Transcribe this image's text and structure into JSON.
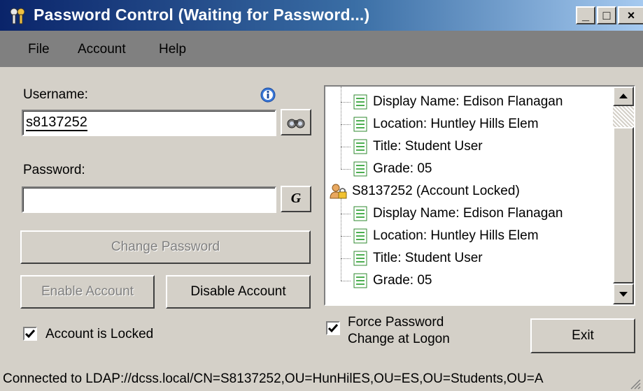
{
  "window": {
    "title": "Password Control  (Waiting for Password...)",
    "controls": {
      "minimize": "_",
      "maximize": "□",
      "close": "×"
    }
  },
  "menu": {
    "items": [
      "File",
      "Account",
      "Help"
    ]
  },
  "username": {
    "label": "Username:",
    "value": "s8137252",
    "info_icon": "info-icon",
    "lookup_icon": "binoculars-icon"
  },
  "password": {
    "label": "Password:",
    "value": "",
    "generate_label": "G"
  },
  "buttons": {
    "change_password": "Change Password",
    "enable_account": "Enable Account",
    "disable_account": "Disable Account",
    "exit": "Exit"
  },
  "checks": {
    "account_locked": {
      "label": "Account is Locked",
      "checked": true
    },
    "force_change": {
      "line1": "Force Password",
      "line2": "Change at Logon",
      "checked": true
    }
  },
  "tree": {
    "rows": [
      {
        "level": 1,
        "icon": "document-icon",
        "text": "Display Name: Edison Flanagan"
      },
      {
        "level": 1,
        "icon": "document-icon",
        "text": "Location: Huntley Hills Elem"
      },
      {
        "level": 1,
        "icon": "document-icon",
        "text": "Title: Student User"
      },
      {
        "level": 1,
        "icon": "document-icon",
        "text": "Grade: 05"
      },
      {
        "level": 0,
        "icon": "locked-user-icon",
        "text": "S8137252 (Account Locked)"
      },
      {
        "level": 1,
        "icon": "document-icon",
        "text": "Display Name: Edison Flanagan"
      },
      {
        "level": 1,
        "icon": "document-icon",
        "text": "Location: Huntley Hills Elem"
      },
      {
        "level": 1,
        "icon": "document-icon",
        "text": "Title: Student User"
      },
      {
        "level": 1,
        "icon": "document-icon",
        "text": "Grade: 05"
      }
    ]
  },
  "status": {
    "text": "Connected to LDAP://dcss.local/CN=S8137252,OU=HunHilES,OU=ES,OU=Students,OU=A"
  },
  "colors": {
    "titlebar_start": "#0a246a",
    "titlebar_end": "#a6caf0",
    "face": "#d4d0c8",
    "menubar": "#808080"
  }
}
